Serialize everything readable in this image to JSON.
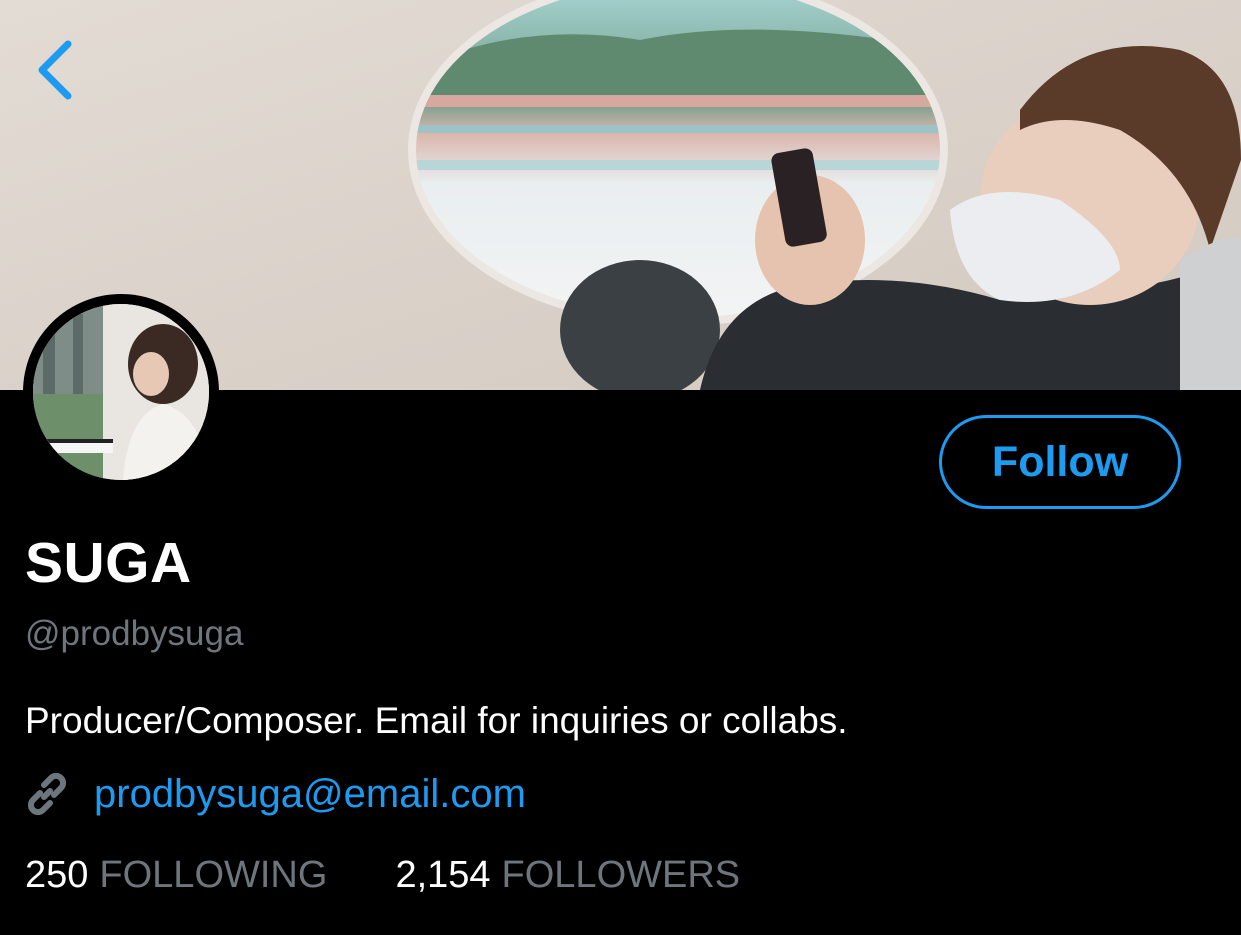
{
  "header": {
    "back_icon": "chevron-left-icon",
    "accent_color": "#1d9bf0"
  },
  "profile": {
    "display_name": "SUGA",
    "handle": "@prodbysuga",
    "bio": "Producer/Composer. Email for inquiries or collabs.",
    "link_icon": "link-icon",
    "link": "prodbysuga@email.com"
  },
  "actions": {
    "follow_label": "Follow"
  },
  "stats": {
    "following_count": "250",
    "following_label": "FOLLOWING",
    "followers_count": "2,154",
    "followers_label": "FOLLOWERS"
  },
  "colors": {
    "background": "#000000",
    "text_primary": "#ffffff",
    "text_secondary": "#6e767d",
    "link": "#1d9bf0"
  }
}
